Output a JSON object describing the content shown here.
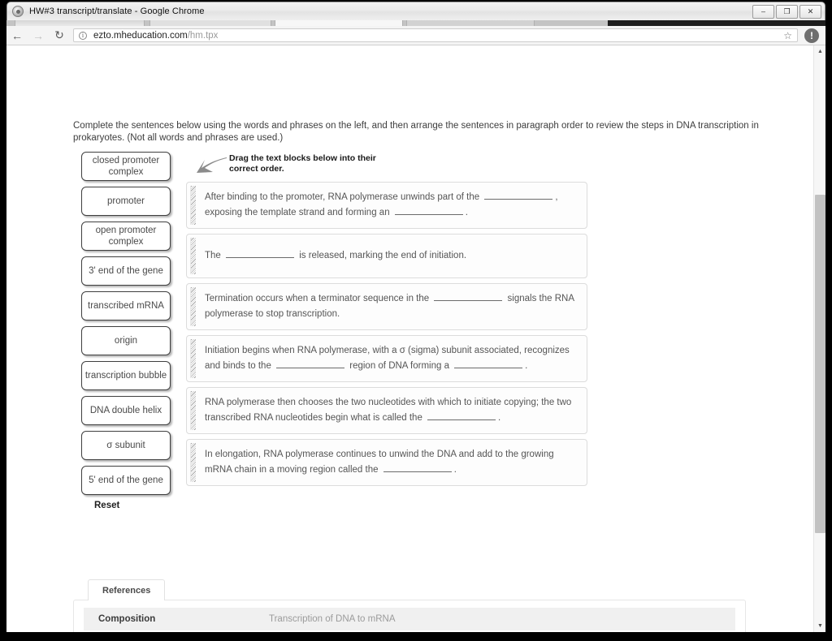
{
  "window": {
    "title": "HW#3 transcript/translate - Google Chrome",
    "app_icon": "chrome-icon",
    "buttons": {
      "minimize": "–",
      "restore": "❐",
      "close": "✕"
    }
  },
  "toolbar": {
    "back": "←",
    "forward": "→",
    "reload": "↻",
    "info_icon": "i",
    "url_domain": "ezto.mheducation.com",
    "url_path": "/hm.tpx",
    "star": "☆",
    "profile_warning": "!"
  },
  "scrollbar": {
    "up_arrow": "▲",
    "down_arrow": "▼"
  },
  "page": {
    "instructions": "Complete the sentences below using the words and phrases on the left, and then arrange the sentences in paragraph order to review the steps in DNA transcription in prokaryotes. (Not all words and phrases are used.)",
    "drag_hint": "Drag the text blocks below into their correct order.",
    "reset_label": "Reset",
    "word_bank": [
      {
        "label": "closed promoter complex",
        "two_line": true
      },
      {
        "label": "promoter",
        "two_line": false
      },
      {
        "label": "open promoter complex",
        "two_line": true
      },
      {
        "label": "3' end of the gene",
        "two_line": false
      },
      {
        "label": "transcribed mRNA",
        "two_line": false
      },
      {
        "label": "origin",
        "two_line": false
      },
      {
        "label": "transcription bubble",
        "two_line": true
      },
      {
        "label": "DNA double helix",
        "two_line": false
      },
      {
        "label": "σ subunit",
        "two_line": false
      },
      {
        "label": "5' end of the gene",
        "two_line": false
      }
    ],
    "blocks": [
      {
        "parts": [
          {
            "t": "text",
            "v": "After binding to the promoter, RNA polymerase unwinds part of the "
          },
          {
            "t": "blank"
          },
          {
            "t": "text",
            "v": ", exposing the template strand and forming an "
          },
          {
            "t": "blank"
          },
          {
            "t": "text",
            "v": "."
          }
        ]
      },
      {
        "parts": [
          {
            "t": "text",
            "v": "The "
          },
          {
            "t": "blank"
          },
          {
            "t": "text",
            "v": " is released, marking the end of initiation."
          }
        ]
      },
      {
        "parts": [
          {
            "t": "text",
            "v": "Termination occurs when a terminator sequence in the "
          },
          {
            "t": "blank"
          },
          {
            "t": "text",
            "v": " signals the RNA polymerase to stop transcription."
          }
        ]
      },
      {
        "parts": [
          {
            "t": "text",
            "v": "Initiation begins when RNA polymerase, with a σ (sigma) subunit associated, recognizes and binds to the "
          },
          {
            "t": "blank"
          },
          {
            "t": "text",
            "v": " region of DNA forming a "
          },
          {
            "t": "blank"
          },
          {
            "t": "text",
            "v": "."
          }
        ]
      },
      {
        "parts": [
          {
            "t": "text",
            "v": "RNA polymerase then chooses the two nucleotides with which to initiate copying; the two transcribed RNA nucleotides begin what is called the "
          },
          {
            "t": "blank"
          },
          {
            "t": "text",
            "v": "."
          }
        ]
      },
      {
        "parts": [
          {
            "t": "text",
            "v": "In elongation, RNA polymerase continues to unwind the DNA and add to the growing mRNA chain in a moving region called the "
          },
          {
            "t": "blank"
          },
          {
            "t": "text",
            "v": "."
          }
        ]
      }
    ],
    "references": {
      "tab_label": "References",
      "row_label": "Composition",
      "row_value": "Transcription of DNA to mRNA"
    }
  },
  "colors": {
    "frame": "#000000",
    "page_bg": "#ffffff",
    "chip_border": "#3f3f3f",
    "block_border": "#dcdcdc",
    "block_text": "#555555",
    "refs_row_bg": "#f0f0f0",
    "refs_value": "#9b9b9b",
    "scroll_thumb": "#c2c2c2"
  }
}
